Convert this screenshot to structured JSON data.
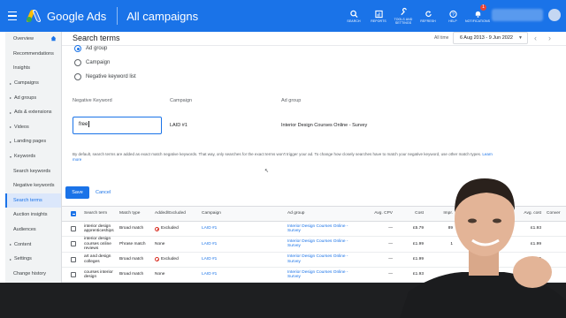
{
  "topbar": {
    "brand": "Google Ads",
    "title": "All campaigns",
    "tools": [
      {
        "icon": "search-icon",
        "label": "SEARCH"
      },
      {
        "icon": "reports-icon",
        "label": "REPORTS"
      },
      {
        "icon": "wrench-icon",
        "label": "TOOLS AND SETTINGS"
      },
      {
        "icon": "refresh-icon",
        "label": "REFRESH"
      },
      {
        "icon": "help-icon",
        "label": "HELP"
      },
      {
        "icon": "bell-icon",
        "label": "NOTIFICATIONS"
      }
    ],
    "notification_count": "1",
    "accent": "#1a73e8"
  },
  "sidebar": {
    "items": [
      {
        "label": "Overview"
      },
      {
        "label": "Recommendations"
      },
      {
        "label": "Insights"
      },
      {
        "label": "Campaigns"
      },
      {
        "label": "Ad groups"
      },
      {
        "label": "Ads & extensions"
      },
      {
        "label": "Videos"
      },
      {
        "label": "Landing pages"
      },
      {
        "label": "Keywords"
      },
      {
        "label": "Search keywords"
      },
      {
        "label": "Negative keywords"
      },
      {
        "label": "Search terms"
      },
      {
        "label": "Auction insights"
      },
      {
        "label": "Audiences"
      },
      {
        "label": "Content"
      },
      {
        "label": "Settings"
      },
      {
        "label": "Change history"
      }
    ]
  },
  "header": {
    "title": "Search terms",
    "alltime": "All time",
    "daterange": "6 Aug 2013 - 9 Jun 2022"
  },
  "form": {
    "options": [
      "Ad group",
      "Campaign",
      "Negative keyword list"
    ],
    "col_keyword": "Negative Keyword",
    "col_campaign": "Campaign",
    "col_adgroup": "Ad group",
    "keyword_value": "free",
    "campaign_value": "LAID #1",
    "adgroup_value": "Interior Design Courses Online - Survey",
    "note": "By default, search terms are added as exact match negative keywords. That way, only searches for the exact terms won't trigger your ad. To change how closely searches have to match your negative keyword, use other match types.",
    "learn_more_a": "Learn",
    "learn_more_b": "more",
    "save": "Save",
    "cancel": "Cancel"
  },
  "table": {
    "headers": [
      "Search term",
      "Match type",
      "Added/Excluded",
      "Campaign",
      "Ad group",
      "Avg. CPV",
      "Cost",
      "Impr.",
      "Avg. cost",
      "Conver"
    ],
    "rows": [
      {
        "term": "interior design apprenticeships",
        "match": "Broad match",
        "status": "Excluded",
        "campaign": "LAID #1",
        "adgroup": "Interior Design Courses Online - Survey",
        "cpv": "—",
        "cost": "£5.79",
        "impr": "89",
        "avgcost": "£1.93"
      },
      {
        "term": "interior design courses online reviews",
        "match": "Phrase match",
        "status": "None",
        "campaign": "LAID #1",
        "adgroup": "Interior Design Courses Online - Survey",
        "cpv": "—",
        "cost": "£1.99",
        "impr": "1",
        "avgcost": "£1.99"
      },
      {
        "term": "art and design colleges",
        "match": "Broad match",
        "status": "Excluded",
        "campaign": "LAID #1",
        "adgroup": "Interior Design Courses Online - Survey",
        "cpv": "—",
        "cost": "£1.99",
        "impr": "",
        "avgcost": "£1.99"
      },
      {
        "term": "courses interior design",
        "match": "Broad match",
        "status": "None",
        "campaign": "LAID #1",
        "adgroup": "Interior Design Courses Online - Survey",
        "cpv": "—",
        "cost": "£1.93",
        "impr": "",
        "avgcost": "£1.93"
      }
    ]
  }
}
